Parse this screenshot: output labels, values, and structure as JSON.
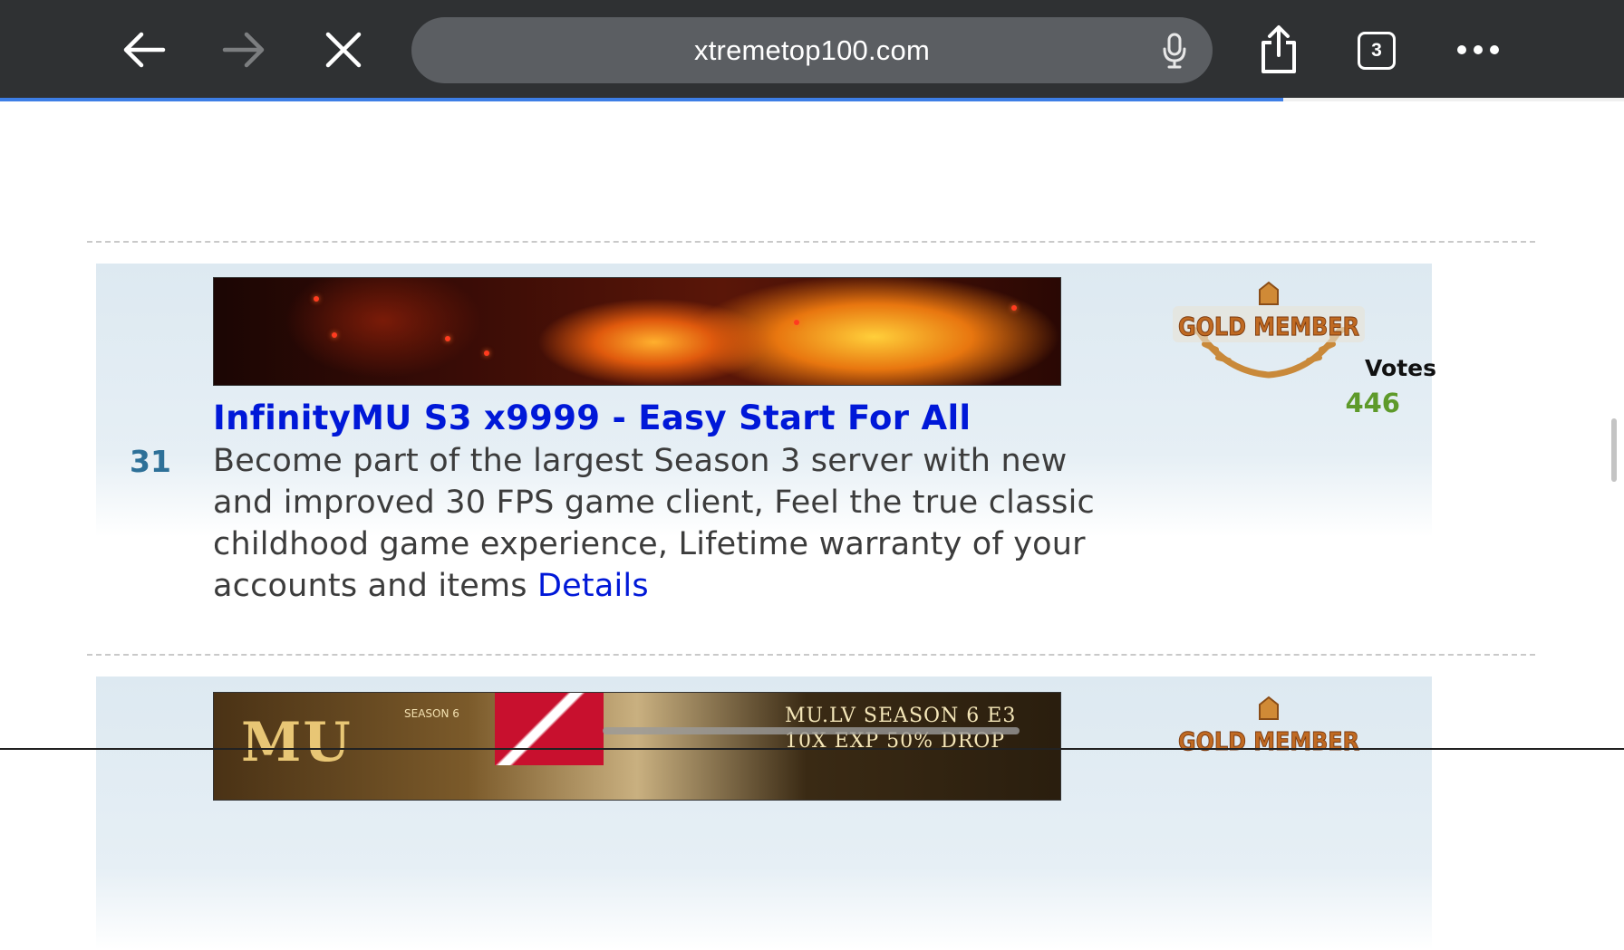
{
  "browser": {
    "url": "xtremetop100.com",
    "tab_count": "3",
    "load_progress": 0.79,
    "icons": [
      "back-arrow-icon",
      "forward-arrow-icon",
      "close-icon",
      "microphone-icon",
      "share-icon",
      "tabs-icon",
      "more-icon"
    ]
  },
  "listing": {
    "rank": "31",
    "title": "InfinityMU S3 x9999 - Easy Start For All",
    "description": "Become part of the largest Season 3 server with new and improved 30 FPS game client, Feel the true classic childhood game experience, Lifetime warranty of your accounts and items",
    "details_link": "Details",
    "badge_text": "GOLD MEMBER",
    "votes_label": "Votes",
    "votes_value": "446"
  },
  "next_listing": {
    "banner_logo": "MU",
    "banner_season": "SEASON 6",
    "banner_line1": "MU.LV SEASON 6 E3",
    "banner_line2": "10X EXP 50% DROP",
    "badge_text": "GOLD MEMBER"
  },
  "colors": {
    "toolbar_bg": "#2f3133",
    "link_blue": "#0018d8",
    "rank_blue": "#2d7098",
    "votes_green": "#5e9a2a",
    "progress_blue": "#3d7ee6"
  }
}
